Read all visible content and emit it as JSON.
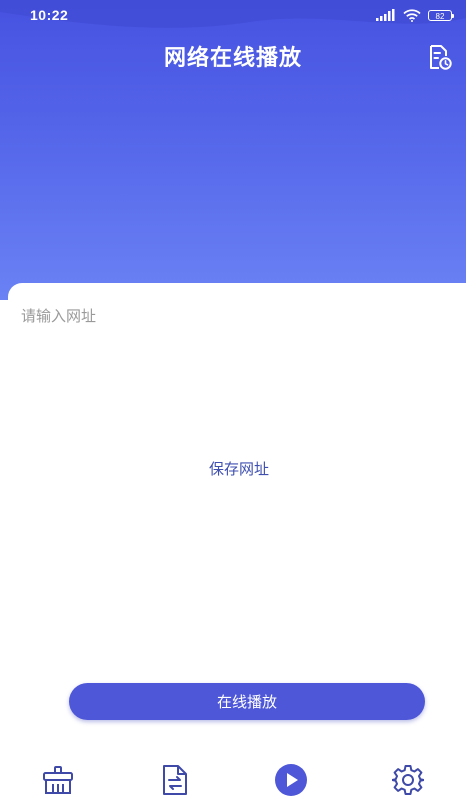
{
  "status_bar": {
    "time": "10:22",
    "battery": "82",
    "icons": [
      "signal-icon",
      "wifi-icon",
      "battery-icon"
    ]
  },
  "header": {
    "title": "网络在线播放",
    "history_icon": "document-clock-icon"
  },
  "form": {
    "url_placeholder": "请输入网址",
    "url_value": "",
    "play_label": "在线播放",
    "save_label": "保存网址"
  },
  "tabbar": {
    "items": [
      {
        "icon": "broom-icon",
        "active": false
      },
      {
        "icon": "file-transfer-icon",
        "active": false
      },
      {
        "icon": "play-circle-icon",
        "active": true
      },
      {
        "icon": "gear-icon",
        "active": false
      }
    ]
  },
  "colors": {
    "accent": "#4d57d8",
    "header_gradient_top": "#4652e0",
    "header_gradient_bottom": "#6a82f4",
    "tab_icon": "#3f4aa8",
    "link": "#3e4fb0"
  }
}
